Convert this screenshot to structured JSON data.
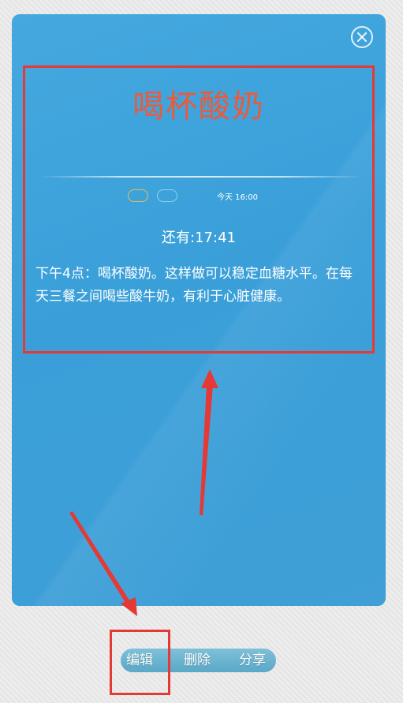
{
  "reminder": {
    "title": "喝杯酸奶",
    "tags": [
      "",
      ""
    ],
    "datetime": "今天 16:00",
    "countdown": "还有:17:41",
    "content": "下午4点：喝杯酸奶。这样做可以稳定血糖水平。在每天三餐之间喝些酸牛奶，有利于心脏健康。"
  },
  "actions": {
    "edit_label": "编辑",
    "delete_label": "删除",
    "share_label": "分享"
  },
  "colors": {
    "card_bg": "#3a9fd9",
    "title": "#ea5a3c",
    "annotation": "#e53935",
    "tag_yellow": "#e8c04a",
    "tag_blue": "#8fd0f4"
  },
  "icons": {
    "close": "close-circle-icon"
  }
}
